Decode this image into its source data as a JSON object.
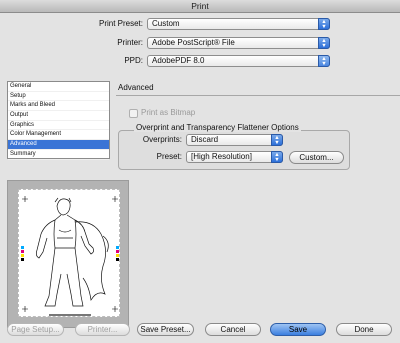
{
  "window": {
    "title": "Print"
  },
  "settings": {
    "preset_label": "Print Preset:",
    "preset_value": "Custom",
    "printer_label": "Printer:",
    "printer_value": "Adobe PostScript® File",
    "ppd_label": "PPD:",
    "ppd_value": "AdobePDF 8.0"
  },
  "sidebar": {
    "items": [
      {
        "label": "General"
      },
      {
        "label": "Setup"
      },
      {
        "label": "Marks and Bleed"
      },
      {
        "label": "Output"
      },
      {
        "label": "Graphics"
      },
      {
        "label": "Color Management"
      },
      {
        "label": "Advanced",
        "selected": true
      },
      {
        "label": "Summary"
      }
    ]
  },
  "advanced": {
    "title": "Advanced",
    "print_as_bitmap": {
      "label": "Print as Bitmap",
      "checked": false,
      "enabled": false
    },
    "flattener_group_title": "Overprint and Transparency Flattener Options",
    "overprints_label": "Overprints:",
    "overprints_value": "Discard",
    "preset_label": "Preset:",
    "preset_value": "[High Resolution]",
    "custom_button": "Custom..."
  },
  "footer": {
    "page_setup": "Page Setup...",
    "printer": "Printer...",
    "save_preset": "Save Preset...",
    "cancel": "Cancel",
    "save": "Save",
    "done": "Done"
  },
  "colors": {
    "accent": "#3a74d6",
    "primary_button": "#3b7fe0"
  },
  "icons": {
    "popup_arrows": "up-down-arrows-icon"
  }
}
